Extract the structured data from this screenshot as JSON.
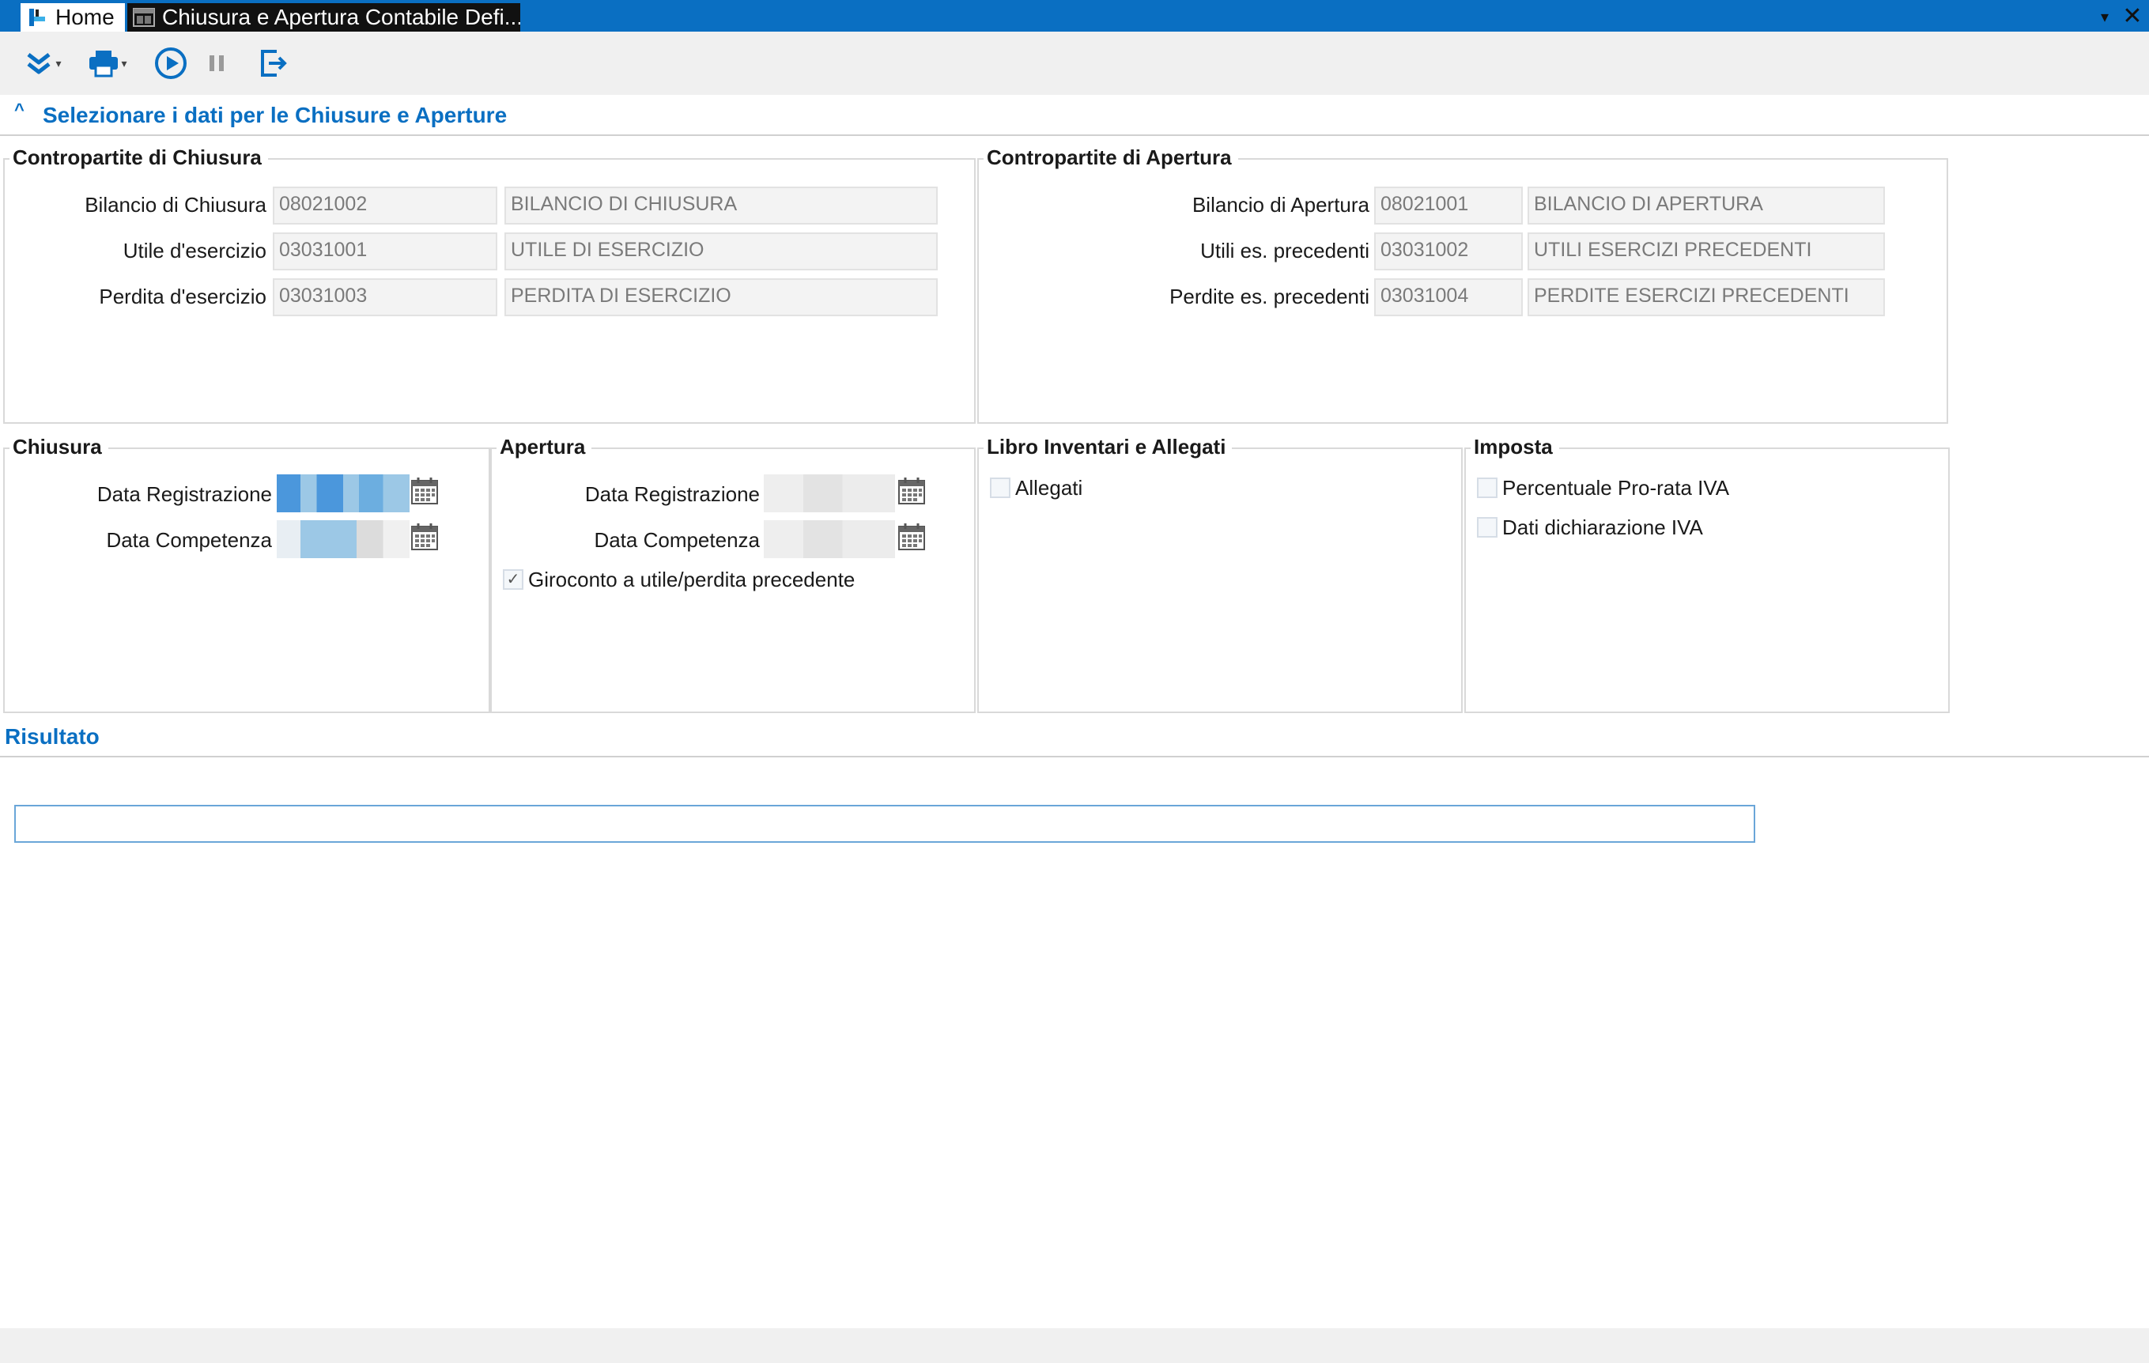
{
  "window": {
    "tabs": [
      {
        "label": "Home"
      },
      {
        "label": "Chiusura e Apertura Contabile Defi..."
      }
    ],
    "controls": {
      "dropdown": "▾",
      "close": "✕"
    }
  },
  "toolbar": {
    "buttons": [
      {
        "name": "expand-icon"
      },
      {
        "name": "print-icon"
      },
      {
        "name": "play-icon"
      },
      {
        "name": "pause-icon"
      },
      {
        "name": "exit-icon"
      }
    ]
  },
  "selection": {
    "collapse_glyph": "^",
    "title": "Selezionare i dati per le Chiusure e Aperture"
  },
  "contropartite_chiusura": {
    "legend": "Contropartite di Chiusura",
    "rows": [
      {
        "label": "Bilancio di Chiusura",
        "code": "08021002",
        "description": "BILANCIO DI CHIUSURA"
      },
      {
        "label": "Utile d'esercizio",
        "code": "03031001",
        "description": "UTILE DI ESERCIZIO"
      },
      {
        "label": "Perdita d'esercizio",
        "code": "03031003",
        "description": "PERDITA DI ESERCIZIO"
      }
    ]
  },
  "contropartite_apertura": {
    "legend": "Contropartite di Apertura",
    "rows": [
      {
        "label": "Bilancio di Apertura",
        "code": "08021001",
        "description": "BILANCIO DI APERTURA"
      },
      {
        "label": "Utili es. precedenti",
        "code": "03031002",
        "description": "UTILI ESERCIZI PRECEDENTI"
      },
      {
        "label": "Perdite es. precedenti",
        "code": "03031004",
        "description": "PERDITE ESERCIZI PRECEDENTI"
      }
    ]
  },
  "chiusura": {
    "legend": "Chiusura",
    "data_registrazione_label": "Data Registrazione",
    "data_competenza_label": "Data Competenza"
  },
  "apertura": {
    "legend": "Apertura",
    "data_registrazione_label": "Data Registrazione",
    "data_competenza_label": "Data Competenza",
    "giroconto_label": "Giroconto a utile/perdita precedente",
    "giroconto_checked": true,
    "check_glyph": "✓"
  },
  "libro": {
    "legend": "Libro Inventari e Allegati",
    "allegati_label": "Allegati",
    "allegati_checked": false
  },
  "imposta": {
    "legend": "Imposta",
    "prorata_label": "Percentuale Pro-rata IVA",
    "prorata_checked": false,
    "dichiarazione_label": "Dati dichiarazione IVA",
    "dichiarazione_checked": false
  },
  "risultato": {
    "title": "Risultato",
    "value": ""
  },
  "colors": {
    "accent": "#0a6fc2",
    "titlebar": "#0a6fc2",
    "toolbar": "#f0f0f0"
  }
}
